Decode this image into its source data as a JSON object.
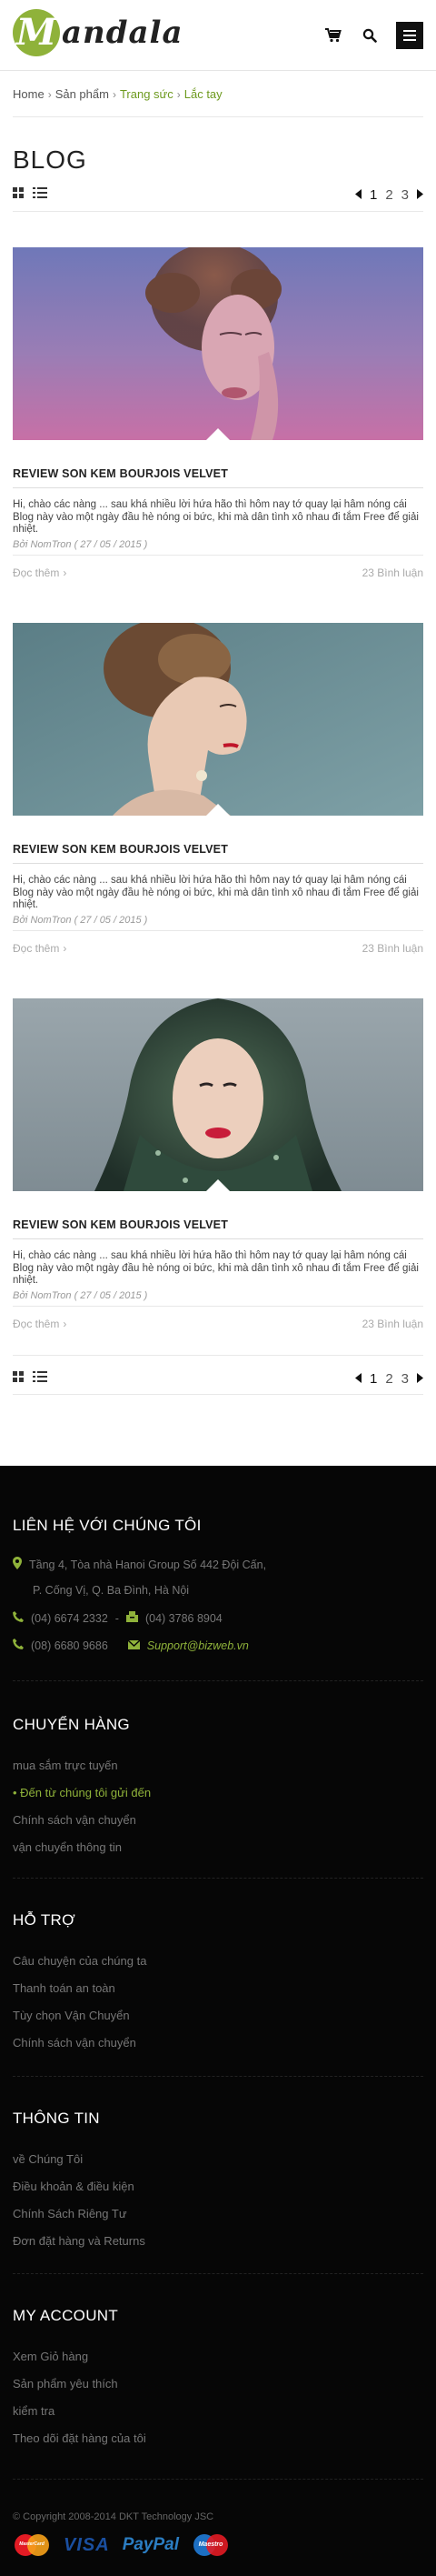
{
  "header": {
    "logo_letter": "M",
    "logo_text": "andala",
    "icons": [
      "cart-icon",
      "search-icon",
      "menu-icon"
    ]
  },
  "breadcrumb": {
    "items": [
      "Home",
      "Sản phẩm",
      "Trang sức",
      "Lắc tay"
    ]
  },
  "page_title": "BLOG",
  "pager": {
    "pages": [
      "1",
      "2",
      "3"
    ],
    "current": "1"
  },
  "posts": [
    {
      "title": "REVIEW SON KEM BOURJOIS VELVET",
      "excerpt": "Hi, chào các nàng ... sau khá nhiều lời hứa hão thì hôm nay tớ quay lại hâm nóng cái Blog này vào một ngày đầu hè nóng oi bức, khi mà dân tình xô nhau đi tắm Free để giải nhiệt.",
      "author": "Bởi NomTron ( 27 / 05 / 2015 )",
      "more": "Đọc thêm",
      "comments": "23 Bình luận"
    },
    {
      "title": "REVIEW SON KEM BOURJOIS VELVET",
      "excerpt": "Hi, chào các nàng ... sau khá nhiều lời hứa hão thì hôm nay tớ quay lại hâm nóng cái Blog này vào một ngày đầu hè nóng oi bức, khi mà dân tình xô nhau đi tắm Free để giải nhiệt.",
      "author": "Bởi NomTron ( 27 / 05 / 2015 )",
      "more": "Đọc thêm",
      "comments": "23 Bình luận"
    },
    {
      "title": "REVIEW SON KEM BOURJOIS VELVET",
      "excerpt": "Hi, chào các nàng ... sau khá nhiều lời hứa hão thì hôm nay tớ quay lại hâm nóng cái Blog này vào một ngày đầu hè nóng oi bức, khi mà dân tình xô nhau đi tắm Free để giải nhiệt.",
      "author": "Bởi NomTron ( 27 / 05 / 2015 )",
      "more": "Đọc thêm",
      "comments": "23 Bình luận"
    }
  ],
  "footer": {
    "contact": {
      "heading": "LIÊN HỆ VỚI CHÚNG TÔI",
      "address_line1": "Tầng 4, Tòa nhà Hanoi Group  Số 442 Đội Cấn,",
      "address_line2": "P. Cống Vị, Q. Ba Đình, Hà Nội",
      "phone1": "(04) 6674 2332",
      "phone2": "(04) 3786 8904",
      "phone3": "(08) 6680 9686",
      "email": "Support@bizweb.vn"
    },
    "shipping": {
      "heading": "CHUYỂN HÀNG",
      "items": [
        "mua sắm trực tuyến",
        "Đến từ chúng tôi gửi đến",
        "Chính sách vận chuyển",
        "vận chuyển thông tin"
      ]
    },
    "support": {
      "heading": "HỖ TRỢ",
      "items": [
        "Câu chuyện của chúng ta",
        "Thanh toán an toàn",
        "Tùy chọn Vận Chuyển",
        "Chính sách vận chuyển"
      ]
    },
    "info": {
      "heading": "THÔNG TIN",
      "items": [
        "về Chúng Tôi",
        "Điều khoản & điều kiện",
        "Chính Sách Riêng Tư",
        "Đơn đặt hàng và Returns"
      ]
    },
    "account": {
      "heading": "MY ACCOUNT",
      "items": [
        "Xem Giỏ hàng",
        "Sản phẩm yêu thích",
        "kiểm tra",
        "Theo dõi đặt hàng của tôi"
      ]
    },
    "copyright": "© Copyright 2008-2014 DKT Technology JSC",
    "payments": {
      "visa": "VISA",
      "paypal": "PayPal",
      "maestro": "Maestro",
      "mastercard": "MasterCard"
    }
  },
  "colors": {
    "accent": "#8fb23a",
    "footer_bg": "#060606"
  }
}
